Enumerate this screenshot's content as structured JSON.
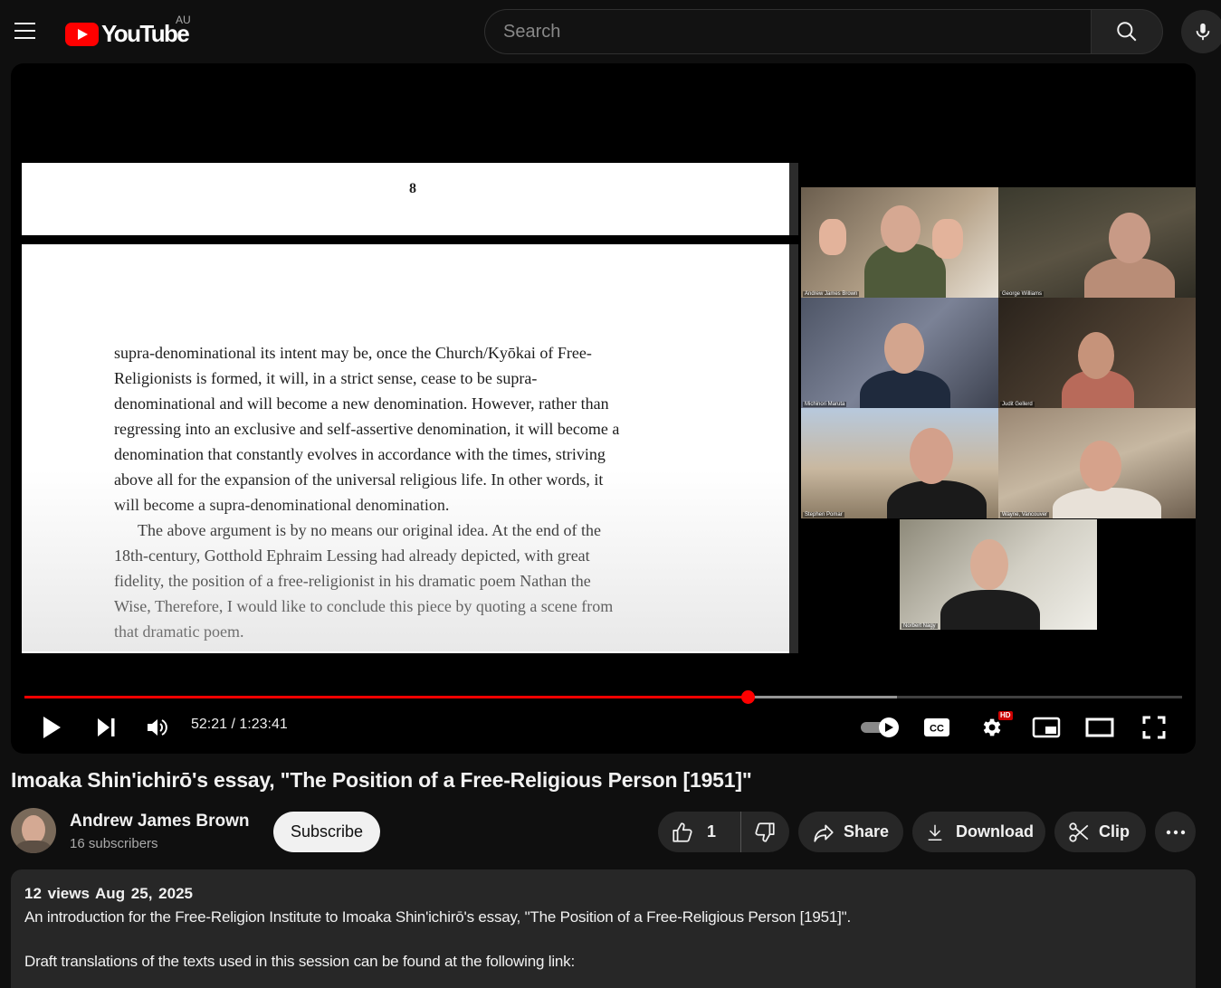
{
  "masthead": {
    "logo_text": "YouTube",
    "country_code": "AU",
    "search_placeholder": "Search"
  },
  "player": {
    "document": {
      "page_number": "8",
      "paragraph1_lines": [
        "supra-denominational its intent may be, once the Church/Kyōkai of Free-",
        "Religionists is formed, it will, in a strict sense, cease to be supra-",
        "denominational and will become a new denomination. However, rather than",
        "regressing into an exclusive and self-assertive denomination, it will become a",
        "denomination that constantly evolves in accordance with the times, striving",
        "above all for the expansion of the universal religious life. In other words, it",
        "will become a supra-denominational denomination."
      ],
      "paragraph2_lines": [
        "The above argument is by no means our original idea. At the end of the",
        "18th-century, Gotthold Ephraim Lessing had already depicted, with great",
        "fidelity, the position of a free-religionist in his dramatic poem Nathan the",
        "Wise, Therefore, I would like to conclude this piece by quoting a scene from",
        "that dramatic poem."
      ]
    },
    "participants": [
      {
        "name": "Andrew James Brown"
      },
      {
        "name": "George Williams"
      },
      {
        "name": "Michinori Maruta"
      },
      {
        "name": "Judit Gellerd"
      },
      {
        "name": "Stephen Pomar"
      },
      {
        "name": "Wayne, Vancouver"
      },
      {
        "name": "Norbert Nagy"
      }
    ],
    "time_display": "52:21 / 1:23:41",
    "progress": {
      "played_fraction": 0.625,
      "buffered_fraction": 0.754
    },
    "hd_badge": "HD",
    "colors": {
      "progress": "#ff0000",
      "brand": "#ff0000"
    }
  },
  "video": {
    "title": "Imoaka Shin'ichirō's essay, \"The Position of a Free-Religious Person [1951]\"",
    "channel_name": "Andrew James Brown",
    "subscribers": "16 subscribers",
    "subscribe_label": "Subscribe",
    "like_count": "1",
    "share_label": "Share",
    "download_label": "Download",
    "clip_label": "Clip"
  },
  "description": {
    "views_date": "12 views  Aug 25, 2025",
    "line1": "An introduction for the Free-Religion Institute to Imoaka Shin'ichirō's essay, \"The Position of a Free-Religious Person [1951]\".",
    "line2": "Draft translations of the texts used in this session can be found at the following link:"
  }
}
